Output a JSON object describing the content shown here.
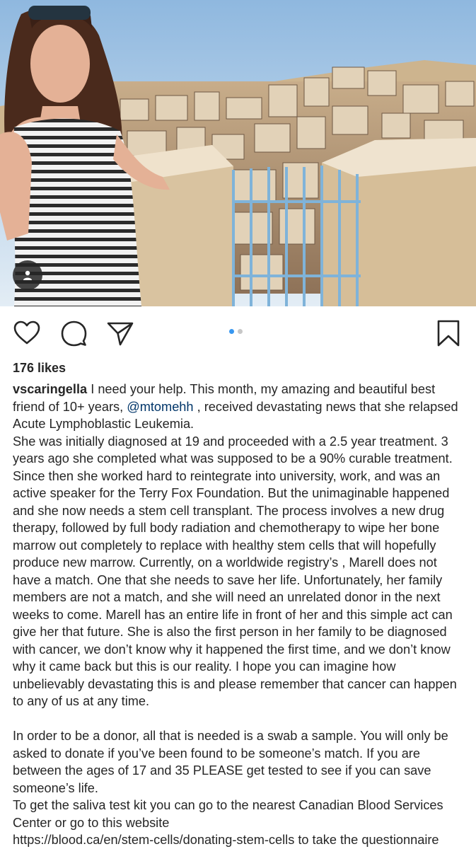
{
  "post": {
    "photo_alt_icon": "user-tag-icon",
    "carousel": {
      "count": 2,
      "active_index": 0,
      "active_color": "#3897f0",
      "inactive_color": "#c7c7c7"
    },
    "icons": {
      "like": "heart-icon",
      "comment": "comment-icon",
      "share": "send-icon",
      "save": "bookmark-icon"
    },
    "likes": "176 likes",
    "caption": {
      "username": "vscaringella",
      "p1_part1": " I need your help. This month, my amazing and beautiful best friend of 10+ years, ",
      "mention": "@mtomehh",
      "p1_part2": " , received devastating news that she relapsed Acute Lymphoblastic Leukemia.",
      "p2": "She was initially diagnosed at 19 and proceeded with a 2.5 year treatment. 3 years ago she completed what was supposed to be a 90% curable treatment. Since then she worked hard to reintegrate into university, work, and was an active speaker for the Terry Fox Foundation. But the unimaginable happened and she now needs a stem cell transplant. The process involves a new drug therapy, followed by full body radiation and chemotherapy to wipe her bone marrow out completely to replace with healthy stem cells that will hopefully produce new marrow. Currently, on a worldwide registry’s , Marell does not have a match. One that she needs to save her life. Unfortunately, her family members are not a match, and she will need an unrelated donor in the next weeks to come. Marell has an entire life in front of her and this simple act can give her that future. She is also the first person in her family to be diagnosed with cancer, we don’t know why it happened the first time, and we don’t know why it came back but this is our reality.  I hope you can imagine how unbelievably devastating this is and please remember that cancer can happen to any of us at any time.",
      "p3": "In order to be a donor, all that is needed is a swab a sample. You will only be asked to donate if you’ve been found to be someone’s match. If you are between the ages of 17 and 35 PLEASE get tested to see if you can save someone’s life.",
      "p4": "To get the saliva test kit you can go to the nearest Canadian Blood Services Center or go to this website",
      "p5": "https://blood.ca/en/stem-cells/donating-stem-cells to take the questionnaire"
    }
  }
}
